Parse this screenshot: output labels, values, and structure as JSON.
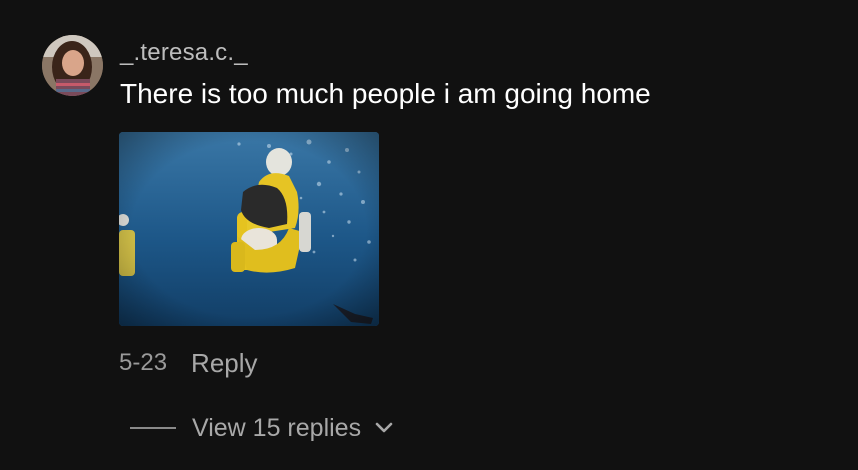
{
  "comment": {
    "username": "_.teresa.c._",
    "text": "There is too much people i am going home",
    "date": "5-23",
    "reply_label": "Reply"
  },
  "replies": {
    "view_label": "View 15 replies"
  },
  "icons": {
    "expand": "chevron-down-icon"
  },
  "colors": {
    "background": "#111111",
    "primary_text": "#ffffff",
    "secondary_text": "#a8a8a8"
  }
}
